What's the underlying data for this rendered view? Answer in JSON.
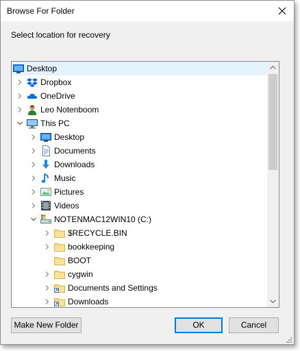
{
  "window": {
    "title": "Browse For Folder"
  },
  "prompt": "Select location for recovery",
  "tree": [
    {
      "label": "Desktop",
      "level": 0,
      "expander": "none",
      "icon": "desktop-icon",
      "selected": true
    },
    {
      "label": "Dropbox",
      "level": 1,
      "expander": "collapsed",
      "icon": "dropbox-icon"
    },
    {
      "label": "OneDrive",
      "level": 1,
      "expander": "collapsed",
      "icon": "onedrive-icon"
    },
    {
      "label": "Leo Notenboom",
      "level": 1,
      "expander": "collapsed",
      "icon": "user-icon"
    },
    {
      "label": "This PC",
      "level": 1,
      "expander": "expanded",
      "icon": "computer-icon"
    },
    {
      "label": "Desktop",
      "level": 2,
      "expander": "collapsed",
      "icon": "desktop-icon"
    },
    {
      "label": "Documents",
      "level": 2,
      "expander": "collapsed",
      "icon": "documents-icon"
    },
    {
      "label": "Downloads",
      "level": 2,
      "expander": "collapsed",
      "icon": "downloads-icon"
    },
    {
      "label": "Music",
      "level": 2,
      "expander": "collapsed",
      "icon": "music-icon"
    },
    {
      "label": "Pictures",
      "level": 2,
      "expander": "collapsed",
      "icon": "pictures-icon"
    },
    {
      "label": "Videos",
      "level": 2,
      "expander": "collapsed",
      "icon": "videos-icon"
    },
    {
      "label": "NOTENMAC12WIN10 (C:)",
      "level": 2,
      "expander": "expanded",
      "icon": "drive-icon"
    },
    {
      "label": "$RECYCLE.BIN",
      "level": 3,
      "expander": "collapsed",
      "icon": "folder-icon"
    },
    {
      "label": "bookkeeping",
      "level": 3,
      "expander": "collapsed",
      "icon": "folder-icon"
    },
    {
      "label": "BOOT",
      "level": 3,
      "expander": "none",
      "icon": "folder-icon"
    },
    {
      "label": "cygwin",
      "level": 3,
      "expander": "collapsed",
      "icon": "folder-icon"
    },
    {
      "label": "Documents and Settings",
      "level": 3,
      "expander": "collapsed",
      "icon": "folder-shortcut-icon"
    },
    {
      "label": "Downloads",
      "level": 3,
      "expander": "collapsed",
      "icon": "folder-shortcut-icon"
    }
  ],
  "buttons": {
    "make_new_folder": "Make New Folder",
    "ok": "OK",
    "cancel": "Cancel"
  },
  "colors": {
    "selection": "#e5f3ff",
    "accent": "#0078d7",
    "folder": "#f8d775"
  }
}
